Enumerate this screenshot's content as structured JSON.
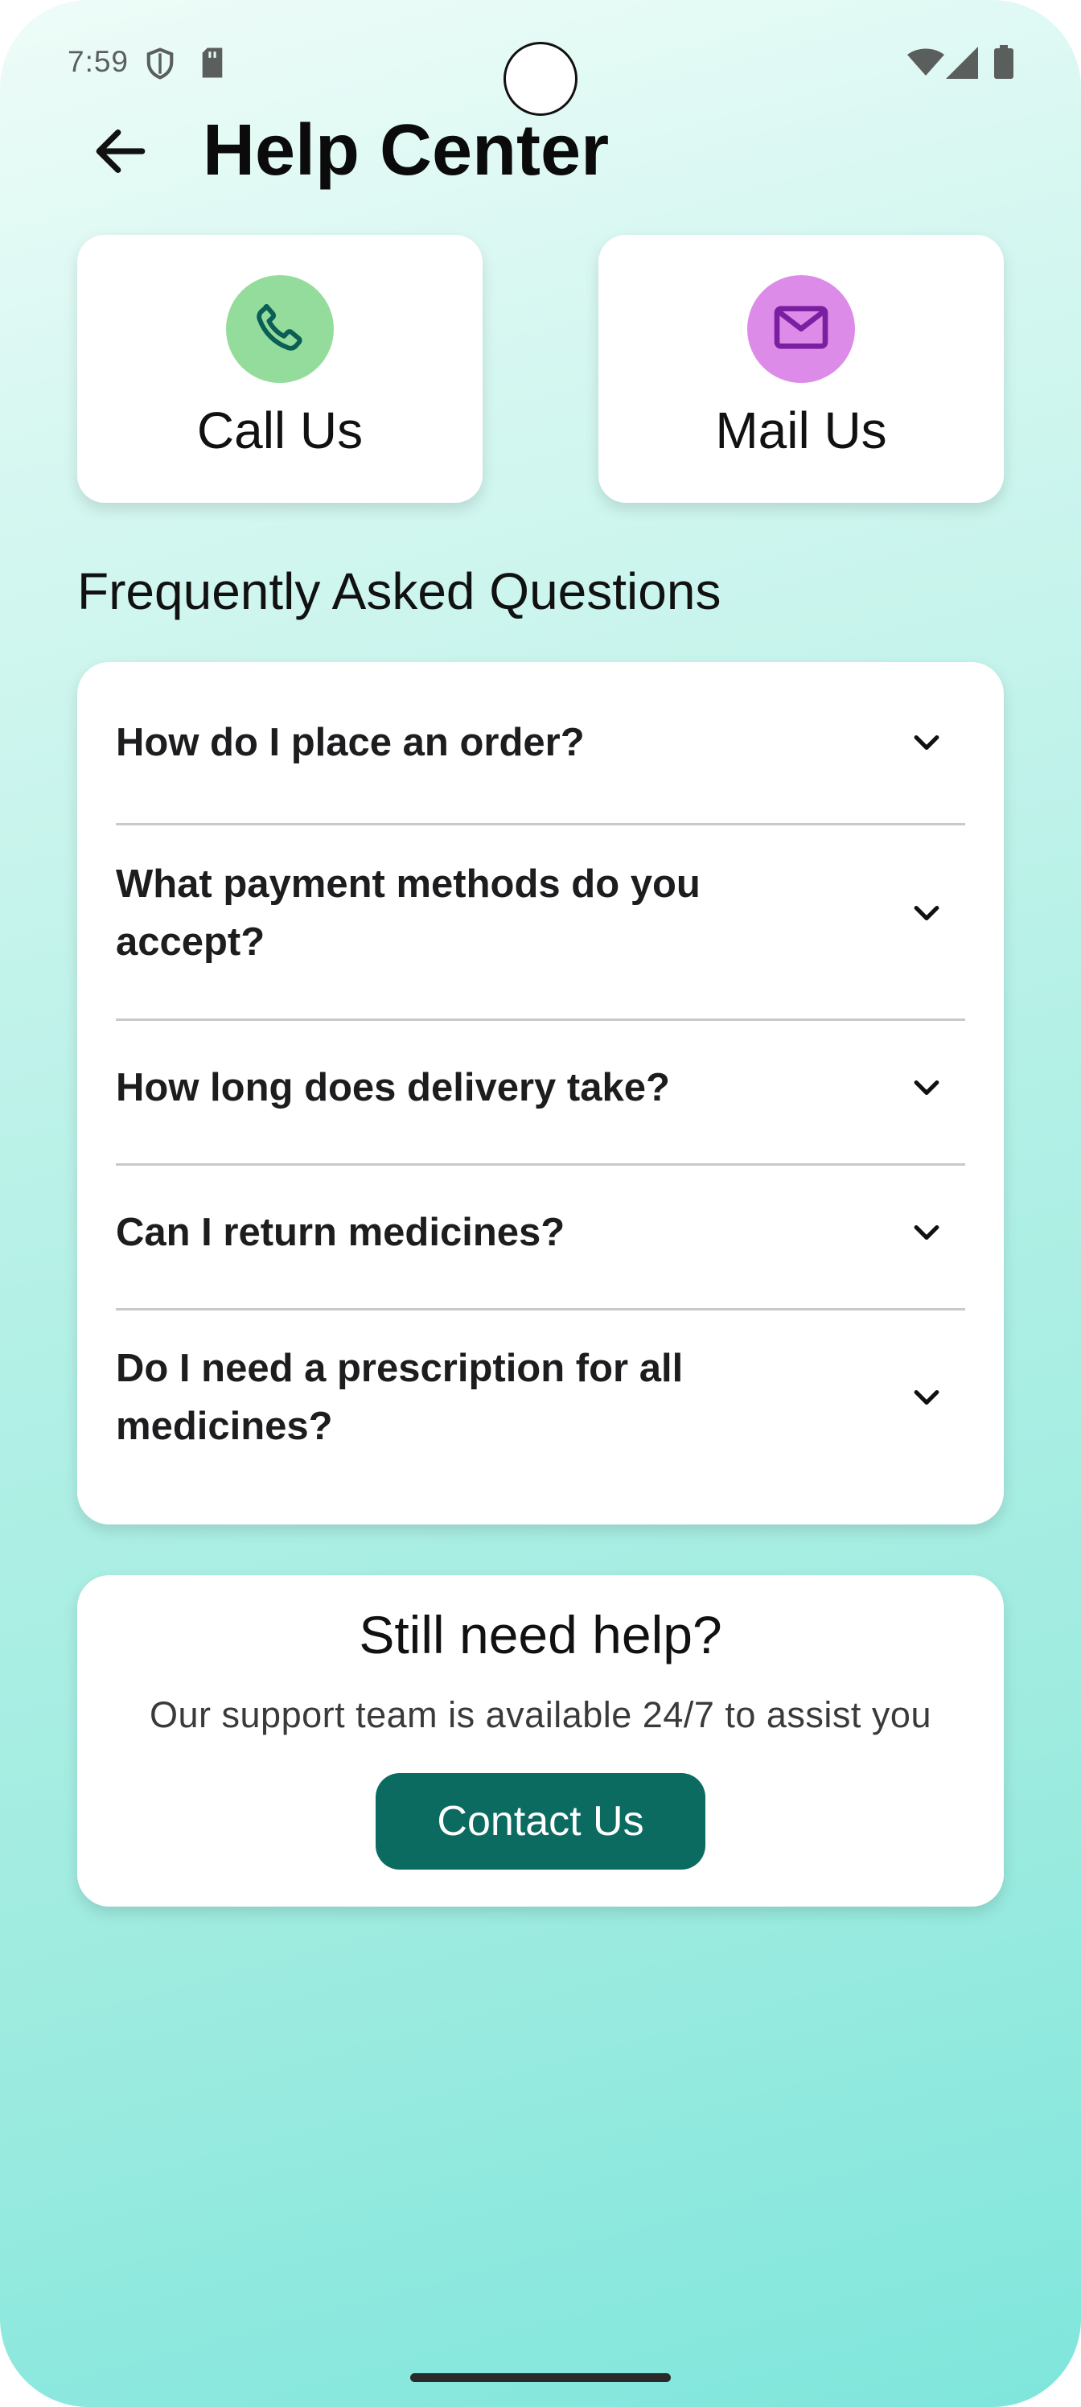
{
  "status_bar": {
    "time": "7:59",
    "icons": [
      "shield-icon",
      "sd-card-icon",
      "wifi-icon",
      "signal-icon",
      "battery-icon"
    ]
  },
  "header": {
    "back_icon": "arrow-left-icon",
    "title": "Help Center"
  },
  "contact_options": [
    {
      "label": "Call Us",
      "icon": "phone-icon",
      "icon_bg": "#94dc9b",
      "icon_color": "#0b5e55"
    },
    {
      "label": "Mail Us",
      "icon": "mail-icon",
      "icon_bg": "#dc8ce8",
      "icon_color": "#7b1fa2"
    }
  ],
  "faq": {
    "title": "Frequently Asked Questions",
    "items": [
      {
        "question": "How do I place an order?"
      },
      {
        "question": "What payment methods do you accept?"
      },
      {
        "question": "How long does delivery take?"
      },
      {
        "question": "Can I return medicines?"
      },
      {
        "question": "Do I need a prescription for all medicines?"
      }
    ]
  },
  "support": {
    "title": "Still need help?",
    "subtitle": "Our support team is available 24/7 to assist you",
    "button_label": "Contact Us"
  },
  "colors": {
    "accent": "#0b6b60",
    "background_top": "#eefcf8",
    "background_bottom": "#7fe6dc"
  }
}
